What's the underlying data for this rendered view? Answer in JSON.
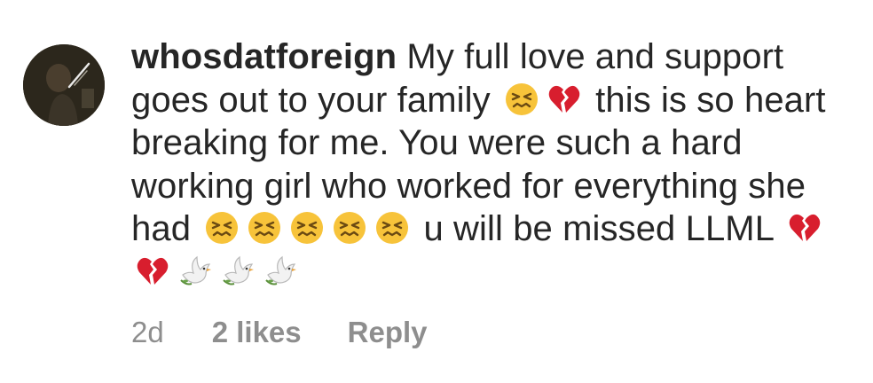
{
  "comment": {
    "username": "whosdatforeign",
    "segments": [
      {
        "type": "text",
        "value": " My full love and support goes out to your family "
      },
      {
        "type": "icon",
        "name": "confounded-face-icon"
      },
      {
        "type": "icon",
        "name": "broken-heart-icon"
      },
      {
        "type": "text",
        "value": " this is so heart breaking for me. You were such a hard working girl who worked for everything she had "
      },
      {
        "type": "icon",
        "name": "confounded-face-icon"
      },
      {
        "type": "icon",
        "name": "confounded-face-icon"
      },
      {
        "type": "icon",
        "name": "confounded-face-icon"
      },
      {
        "type": "icon",
        "name": "confounded-face-icon"
      },
      {
        "type": "icon",
        "name": "confounded-face-icon"
      },
      {
        "type": "text",
        "value": " u will be missed LLML "
      },
      {
        "type": "icon",
        "name": "broken-heart-icon"
      },
      {
        "type": "icon",
        "name": "broken-heart-icon"
      },
      {
        "type": "icon",
        "name": "dove-icon"
      },
      {
        "type": "icon",
        "name": "dove-icon"
      },
      {
        "type": "icon",
        "name": "dove-icon"
      }
    ],
    "time": "2d",
    "likes": "2 likes",
    "reply": "Reply"
  },
  "colors": {
    "text": "#262626",
    "meta": "#8e8e8e",
    "emoji_face": "#f7c33a",
    "broken_heart": "#d81e2e"
  }
}
